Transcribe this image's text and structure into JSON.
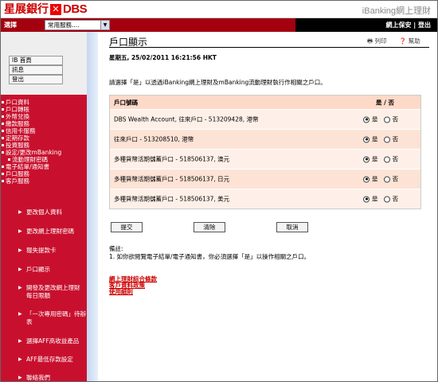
{
  "header": {
    "logo_cn": "星展銀行",
    "logo_x": "✕",
    "logo_en": "DBS",
    "product": "iBanking網上理財"
  },
  "bar": {
    "select_label": "選擇",
    "menu_value": "常用服務....",
    "security": "網上保安",
    "logout": "登出"
  },
  "sidebar": {
    "buttons": [
      "IB 首頁",
      "訊息",
      "登出"
    ],
    "nav": [
      "戶口資料",
      "戶口轉賬",
      "外幣兌換",
      "繳款服務",
      "信用卡服務",
      "定期存款",
      "投資服務",
      "設定/更改mBanking",
      "流動理財密碼",
      "電子結單/通知書",
      "戶口服務",
      "客戶服務"
    ],
    "sub": [
      "更改個人資料",
      "更改網上理財密碼",
      "報失提款卡",
      "戶口顯示",
      "開發及更改網上理財",
      "每日限額",
      "「一次專用密碼」待辦",
      "表",
      "選擇AFF高收益產品",
      "AFF最低存款設定",
      "聯絡我們"
    ]
  },
  "main": {
    "title": "戶口顯示",
    "print": "列印",
    "help": "幫助",
    "datetime": "星期五, 25/02/2011 16:21:56 HKT",
    "instruction": "請選擇「是」以透過iBanking網上理財及mBanking流動理財執行作相關之戶口。",
    "col_account": "戶口號碼",
    "col_yesno": "是 / 否",
    "yes": "是",
    "no": "否",
    "rows": [
      "DBS Wealth Account, 往來戶口 - 513209428, 港幣",
      "往來戶口 - 513208510, 港幣",
      "多種貨幣活期儲蓄戶口 - 518506137, 澳元",
      "多種貨幣活期儲蓄戶口 - 518506137, 日元",
      "多種貨幣活期儲蓄戶口 - 518506137, 美元"
    ],
    "submit": "提交",
    "clear": "清除",
    "cancel": "取消",
    "note_title": "備註:",
    "note_1": "1.   如你欲閱覽電子結單/電子通知書，你必須選擇「是」以操作相關之戶口。",
    "links": [
      "網上理財綜合條款",
      "客戶資料政策",
      "使用細則"
    ]
  },
  "colors": {
    "brand_red": "#a30010",
    "accent_red": "#c8102e"
  }
}
